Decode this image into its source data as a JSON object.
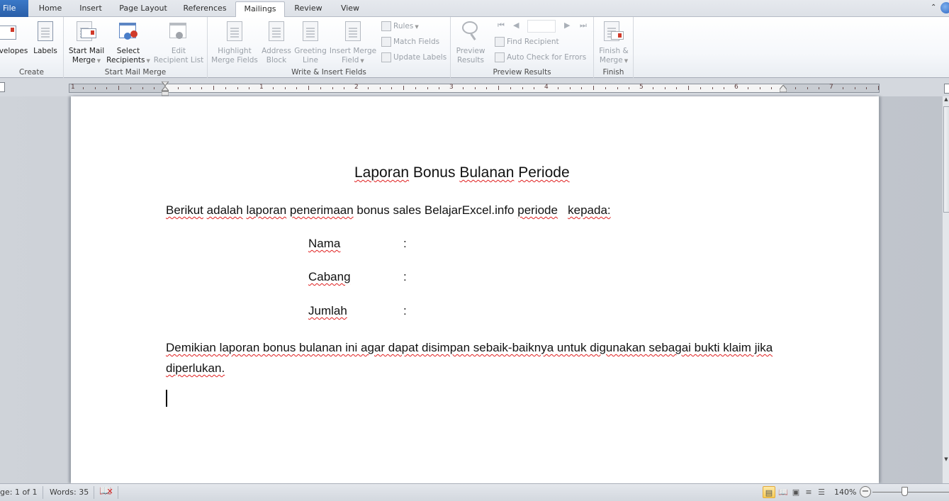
{
  "tabs": [
    {
      "label": "File",
      "active": false
    },
    {
      "label": "Home",
      "active": false
    },
    {
      "label": "Insert",
      "active": false
    },
    {
      "label": "Page Layout",
      "active": false
    },
    {
      "label": "References",
      "active": false
    },
    {
      "label": "Mailings",
      "active": true
    },
    {
      "label": "Review",
      "active": false
    },
    {
      "label": "View",
      "active": false
    }
  ],
  "ribbon": {
    "groups": {
      "create": {
        "label": "Create",
        "envelopes": "velopes",
        "labels": "Labels"
      },
      "start_mail_merge": {
        "label": "Start Mail Merge",
        "start_mail_merge_l1": "Start Mail",
        "start_mail_merge_l2": "Merge",
        "select_recipients_l1": "Select",
        "select_recipients_l2": "Recipients",
        "edit_recipient_list_l1": "Edit",
        "edit_recipient_list_l2": "Recipient List"
      },
      "write_insert_fields": {
        "label": "Write & Insert Fields",
        "highlight_l1": "Highlight",
        "highlight_l2": "Merge Fields",
        "address_l1": "Address",
        "address_l2": "Block",
        "greeting_l1": "Greeting",
        "greeting_l2": "Line",
        "insert_field_l1": "Insert Merge",
        "insert_field_l2": "Field",
        "rules": "Rules",
        "match_fields": "Match Fields",
        "update_labels": "Update Labels"
      },
      "preview_results": {
        "label": "Preview Results",
        "preview_l1": "Preview",
        "preview_l2": "Results",
        "record_value": "",
        "find_recipient": "Find Recipient",
        "auto_check": "Auto Check for Errors"
      },
      "finish": {
        "label": "Finish",
        "finish_l1": "Finish &",
        "finish_l2": "Merge"
      }
    }
  },
  "ruler": {
    "labels": [
      "1",
      "1",
      "2",
      "3",
      "4",
      "5",
      "6",
      "7"
    ]
  },
  "document": {
    "title": "Laporan Bonus Bulanan Periode",
    "intro": {
      "w1": "Berikut",
      "w2": "adalah",
      "w3": "laporan",
      "w4": "penerimaan",
      "w5": "bonus sales BelajarExcel.info",
      "w6": "periode",
      "w7": "kepada:"
    },
    "fields": [
      {
        "label": "Nama",
        "sep": ":"
      },
      {
        "label": "Cabang",
        "sep": ":"
      },
      {
        "label": "Jumlah",
        "sep": ":"
      }
    ],
    "closing": "Demikian laporan bonus bulanan ini agar dapat disimpan sebaik-baiknya untuk digunakan sebagai bukti klaim jika diperlukan."
  },
  "statusbar": {
    "page": "ge: 1 of 1",
    "words": "Words: 35",
    "zoom": "140%",
    "zoom_level_percent": 140
  }
}
